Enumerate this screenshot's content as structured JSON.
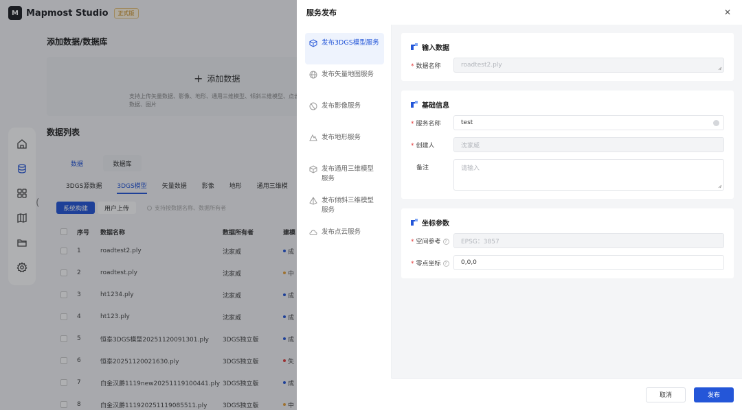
{
  "app": {
    "brand": "Mapmost Studio",
    "edition": "正式版",
    "logo_text": "M"
  },
  "background": {
    "upload_section_title": "添加数据/数据库",
    "upload_button": "添加数据",
    "upload_desc": "支持上传矢量数据、影像、地形、通用三维模型、倾斜三维模型、点云数据、图片",
    "list_title": "数据列表",
    "segments": [
      "数据",
      "数据库"
    ],
    "categories": [
      "3DGS源数据",
      "3DGS模型",
      "矢量数据",
      "影像",
      "地形",
      "通用三维模"
    ],
    "active_category": "3DGS模型",
    "source_tabs": [
      "系统构建",
      "用户上传"
    ],
    "search_hint": "支持按数据名称、数据所有者",
    "table_headers": [
      "序号",
      "数据名称",
      "数据所有者",
      "建模"
    ],
    "rows": [
      {
        "no": "1",
        "name": "roadtest2.ply",
        "owner": "沈家威",
        "status": "成",
        "color": "#2456d8"
      },
      {
        "no": "2",
        "name": "roadtest.ply",
        "owner": "沈家威",
        "status": "中",
        "color": "#e6a23c"
      },
      {
        "no": "3",
        "name": "ht1234.ply",
        "owner": "沈家威",
        "status": "成",
        "color": "#2456d8"
      },
      {
        "no": "4",
        "name": "ht123.ply",
        "owner": "沈家威",
        "status": "成",
        "color": "#2456d8"
      },
      {
        "no": "5",
        "name": "恒泰3DGS模型20251120091301.ply",
        "owner": "3DGS独立版",
        "status": "成",
        "color": "#2456d8"
      },
      {
        "no": "6",
        "name": "恒泰20251120021630.ply",
        "owner": "3DGS独立版",
        "status": "失",
        "color": "#e23d3d"
      },
      {
        "no": "7",
        "name": "白金汉爵1119new20251119100441.ply",
        "owner": "3DGS独立版",
        "status": "成",
        "color": "#2456d8"
      },
      {
        "no": "8",
        "name": "白金汉爵111920251119085511.ply",
        "owner": "3DGS独立版",
        "status": "中",
        "color": "#e6a23c"
      }
    ]
  },
  "drawer": {
    "title": "服务发布",
    "menu": [
      {
        "label": "发布3DGS模型服务",
        "icon": "cube-sparkle-icon",
        "active": true
      },
      {
        "label": "发布矢量地图服务",
        "icon": "globe-icon",
        "active": false
      },
      {
        "label": "发布影像服务",
        "icon": "earth-icon",
        "active": false
      },
      {
        "label": "发布地形服务",
        "icon": "terrain-icon",
        "active": false
      },
      {
        "label": "发布通用三维模型服务",
        "icon": "cube-icon",
        "active": false
      },
      {
        "label": "发布倾斜三维模型服务",
        "icon": "pyramid-icon",
        "active": false
      },
      {
        "label": "发布点云服务",
        "icon": "cloud-icon",
        "active": false
      }
    ],
    "sections": {
      "input": {
        "title": "输入数据",
        "data_name_label": "数据名称",
        "data_name_value": "roadtest2.ply"
      },
      "basic": {
        "title": "基础信息",
        "service_name_label": "服务名称",
        "service_name_value": "test",
        "creator_label": "创建人",
        "creator_value": "沈家威",
        "remark_label": "备注",
        "remark_placeholder": "请输入"
      },
      "coords": {
        "title": "坐标参数",
        "spatial_ref_label": "空间参考",
        "spatial_ref_value": "EPSG：3857",
        "origin_label": "零点坐标",
        "origin_value": "0,0,0"
      }
    },
    "footer": {
      "cancel": "取消",
      "publish": "发布"
    }
  },
  "colors": {
    "accent": "#2456d8",
    "required": "#e23d3d"
  }
}
